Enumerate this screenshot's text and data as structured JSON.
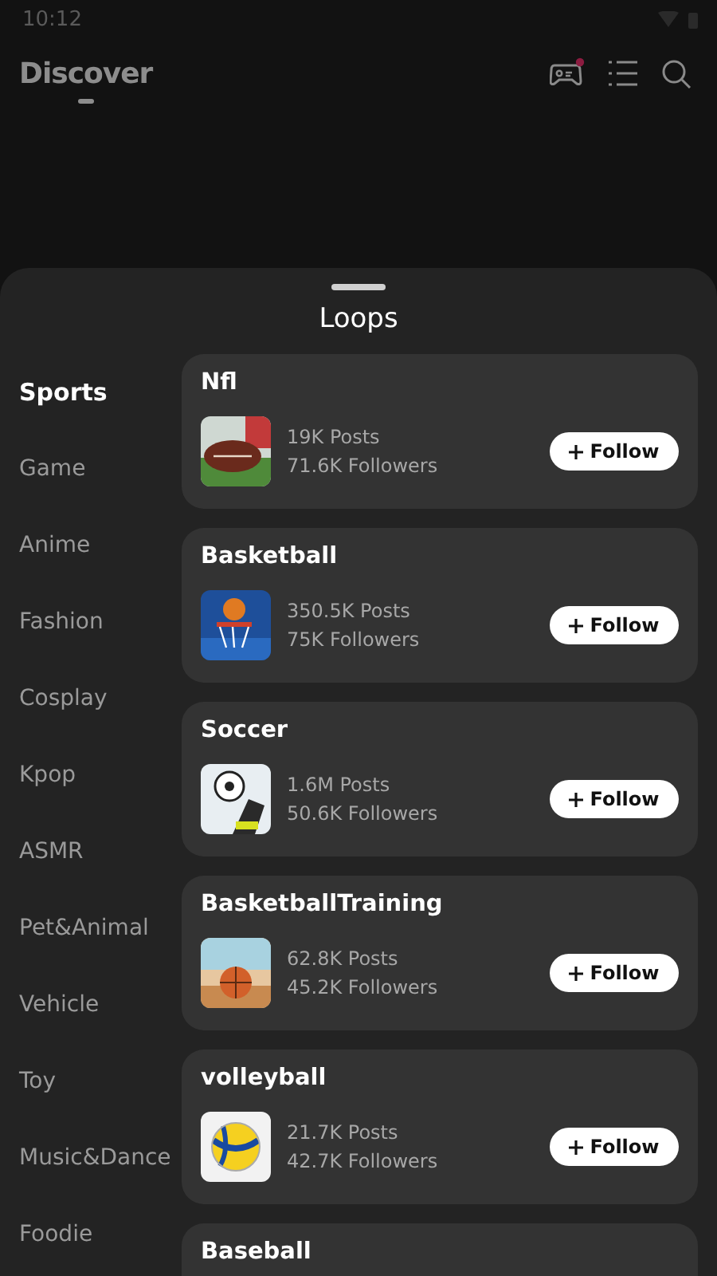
{
  "status_bar": {
    "time": "10:12"
  },
  "header": {
    "title": "Discover",
    "game_badge": true
  },
  "sheet": {
    "title": "Loops"
  },
  "categories": [
    {
      "label": "Sports",
      "selected": true
    },
    {
      "label": "Game",
      "selected": false
    },
    {
      "label": "Anime",
      "selected": false
    },
    {
      "label": "Fashion",
      "selected": false
    },
    {
      "label": "Cosplay",
      "selected": false
    },
    {
      "label": "Kpop",
      "selected": false
    },
    {
      "label": "ASMR",
      "selected": false
    },
    {
      "label": "Pet&Animal",
      "selected": false
    },
    {
      "label": "Vehicle",
      "selected": false
    },
    {
      "label": "Toy",
      "selected": false
    },
    {
      "label": "Music&Dance",
      "selected": false
    },
    {
      "label": "Foodie",
      "selected": false
    }
  ],
  "loops": [
    {
      "name": "Nfl",
      "posts": "19K Posts",
      "followers": "71.6K Followers",
      "button": "Follow"
    },
    {
      "name": "Basketball",
      "posts": "350.5K Posts",
      "followers": "75K Followers",
      "button": "Follow"
    },
    {
      "name": "Soccer",
      "posts": "1.6M Posts",
      "followers": "50.6K Followers",
      "button": "Follow"
    },
    {
      "name": "BasketballTraining",
      "posts": "62.8K Posts",
      "followers": "45.2K Followers",
      "button": "Follow"
    },
    {
      "name": "volleyball",
      "posts": "21.7K Posts",
      "followers": "42.7K Followers",
      "button": "Follow"
    },
    {
      "name": "Baseball"
    }
  ]
}
